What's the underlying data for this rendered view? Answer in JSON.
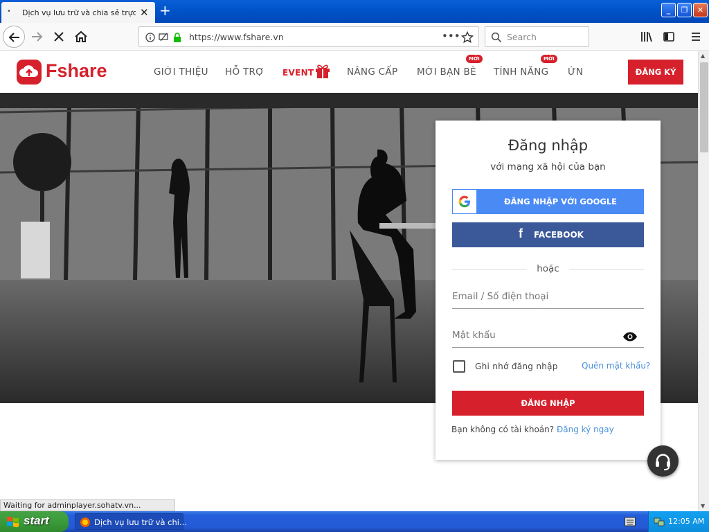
{
  "browser": {
    "tab_title": "Dịch vụ lưu trữ và chia sẻ trực tuyến",
    "url": "https://www.fshare.vn",
    "search_placeholder": "Search",
    "status_text": "Waiting for adminplayer.sohatv.vn..."
  },
  "site": {
    "logo_text": "Fshare",
    "menu": [
      {
        "label": "GIỚI THIỆU"
      },
      {
        "label": "HỖ TRỢ"
      },
      {
        "label": "EVENT"
      },
      {
        "label": "NÂNG CẤP"
      },
      {
        "label": "MỜI BẠN BÈ",
        "badge": "MỚI"
      },
      {
        "label": "TÍNH NĂNG",
        "badge": "MỚI"
      },
      {
        "label": "ỨN"
      }
    ],
    "register_label": "ĐĂNG KÝ"
  },
  "login": {
    "title": "Đăng nhập",
    "subtitle": "với mạng xã hội của bạn",
    "google_label": "ĐĂNG NHẬP VỚI GOOGLE",
    "facebook_label": "FACEBOOK",
    "or_text": "hoặc",
    "email_placeholder": "Email / Số điện thoại",
    "password_placeholder": "Mật khẩu",
    "remember_label": "Ghi nhớ đăng nhập",
    "forgot_label": "Quên mật khẩu?",
    "submit_label": "ĐĂNG NHẬP",
    "no_account_text": "Bạn không có tài khoản?",
    "signup_link": "Đăng ký ngay"
  },
  "taskbar": {
    "start_label": "start",
    "task_label": "Dịch vụ lưu trữ và chi...",
    "clock": "12:05 AM"
  },
  "colors": {
    "brand_red": "#d6202b",
    "google_blue": "#4a8af4",
    "facebook_blue": "#3b5998",
    "link_blue": "#4a90d9"
  }
}
